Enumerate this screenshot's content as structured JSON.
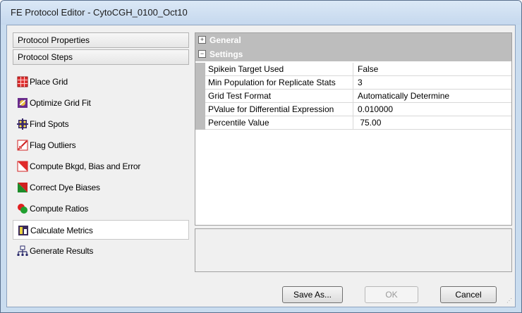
{
  "window": {
    "title": "FE Protocol Editor - CytoCGH_0100_Oct10"
  },
  "left": {
    "protocol_properties": "Protocol Properties",
    "protocol_steps": "Protocol Steps",
    "steps": [
      {
        "label": "Place Grid",
        "icon": "place-grid-icon"
      },
      {
        "label": "Optimize Grid Fit",
        "icon": "optimize-grid-icon"
      },
      {
        "label": "Find Spots",
        "icon": "find-spots-icon"
      },
      {
        "label": "Flag Outliers",
        "icon": "flag-outliers-icon"
      },
      {
        "label": "Compute Bkgd, Bias and Error",
        "icon": "compute-bkgd-icon"
      },
      {
        "label": "Correct Dye Biases",
        "icon": "correct-dye-icon"
      },
      {
        "label": "Compute Ratios",
        "icon": "compute-ratios-icon"
      },
      {
        "label": "Calculate Metrics",
        "icon": "calculate-metrics-icon",
        "selected": true
      },
      {
        "label": "Generate Results",
        "icon": "generate-results-icon"
      }
    ]
  },
  "grid": {
    "categories": [
      {
        "label": "General",
        "toggle": "+"
      },
      {
        "label": "Settings",
        "toggle": "−"
      }
    ],
    "rows": [
      {
        "name": "Spikein Target Used",
        "value": "False"
      },
      {
        "name": "Min Population for Replicate Stats",
        "value": "3"
      },
      {
        "name": "Grid Test Format",
        "value": "Automatically Determine"
      },
      {
        "name": "PValue for Differential Expression",
        "value": "0.010000"
      },
      {
        "name": "Percentile Value",
        "value": " 75.00"
      }
    ]
  },
  "buttons": {
    "save_as": "Save As...",
    "ok": "OK",
    "cancel": "Cancel"
  },
  "colors": {
    "titlebar": "#c9dcef",
    "category_bg": "#bdbdbd",
    "selected_bg": "#ffffff"
  }
}
